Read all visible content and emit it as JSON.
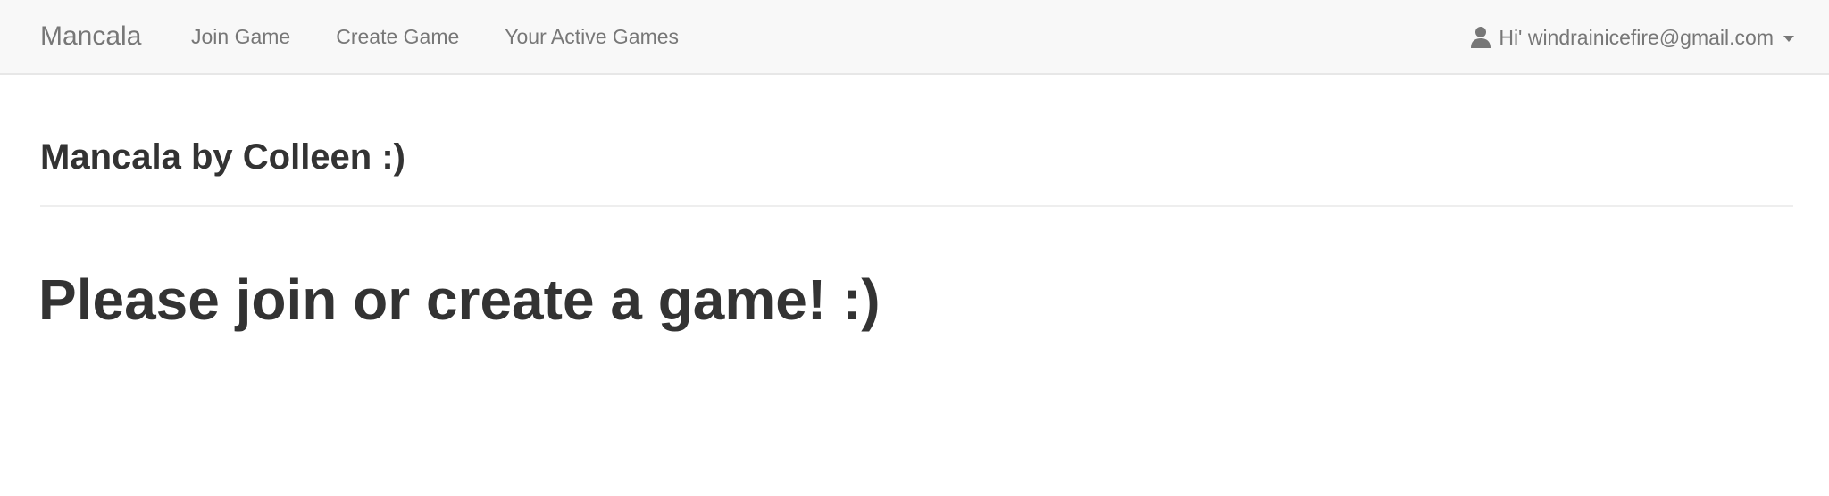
{
  "navbar": {
    "brand": "Mancala",
    "links": [
      {
        "label": "Join Game"
      },
      {
        "label": "Create Game"
      },
      {
        "label": "Your Active Games"
      }
    ],
    "user_menu": {
      "icon": "user-icon",
      "label": "Hi' windrainicefire@gmail.com"
    }
  },
  "main": {
    "header_title": "Mancala by Colleen :)",
    "message": "Please join or create a game! :)"
  },
  "colors": {
    "navbar_bg": "#f8f8f8",
    "nav_text": "#777777",
    "body_text": "#333333"
  }
}
